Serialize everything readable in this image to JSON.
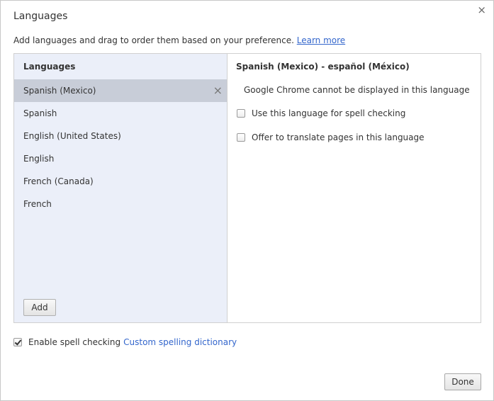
{
  "dialog": {
    "title": "Languages",
    "close_glyph": "×",
    "description": "Add languages and drag to order them based on your preference.",
    "learn_more": "Learn more"
  },
  "left": {
    "header": "Languages",
    "items": [
      {
        "label": "Spanish (Mexico)",
        "selected": true
      },
      {
        "label": "Spanish"
      },
      {
        "label": "English (United States)"
      },
      {
        "label": "English"
      },
      {
        "label": "French (Canada)"
      },
      {
        "label": "French"
      }
    ],
    "remove_glyph": "×",
    "add_label": "Add"
  },
  "right": {
    "header": "Spanish (Mexico) - español (México)",
    "note": "Google Chrome cannot be displayed in this language",
    "spell_check_label": "Use this language for spell checking",
    "spell_check_checked": false,
    "translate_label": "Offer to translate pages in this language",
    "translate_checked": false
  },
  "footer": {
    "enable_spell_label": "Enable spell checking",
    "enable_spell_checked": true,
    "custom_dictionary_link": "Custom spelling dictionary",
    "done_label": "Done"
  },
  "colors": {
    "left_pane_bg": "#ebeff9",
    "selected_item_bg": "#c8cdd8",
    "link": "#3366cc"
  }
}
